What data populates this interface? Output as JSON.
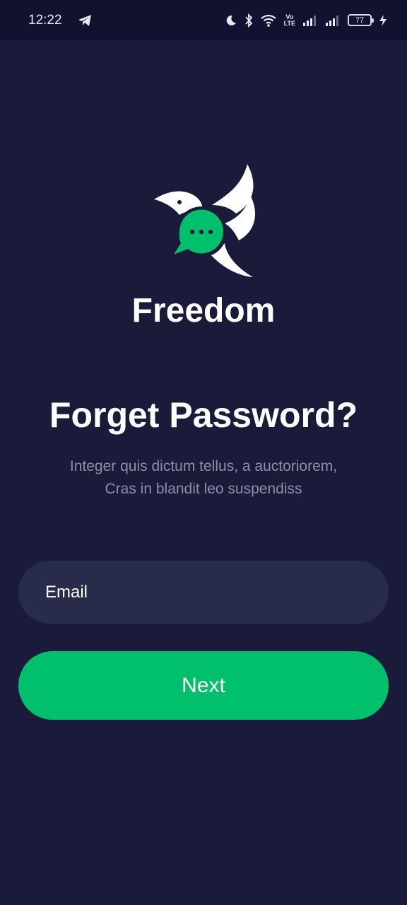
{
  "status_bar": {
    "time": "12:22",
    "volte_label_top": "Vo",
    "volte_label_bottom": "LTE",
    "battery_level": "77",
    "icons": [
      "telegram-icon",
      "moon-icon",
      "bluetooth-icon",
      "wifi-icon",
      "signal-icon",
      "signal-icon",
      "battery-icon",
      "charging-icon"
    ]
  },
  "app": {
    "name": "Freedom",
    "logo_icon": "bird-chat-logo-icon"
  },
  "screen": {
    "title": "Forget Password?",
    "subtitle_line1": "Integer quis dictum tellus, a auctoriorem,",
    "subtitle_line2": "Cras in blandit leo suspendiss"
  },
  "form": {
    "email_placeholder": "Email",
    "email_value": "",
    "next_label": "Next"
  },
  "colors": {
    "background": "#1a1b3a",
    "status_bar": "#111230",
    "input_background": "#292b4b",
    "accent": "#00c06b",
    "subtitle_text": "#8d8ea6"
  }
}
